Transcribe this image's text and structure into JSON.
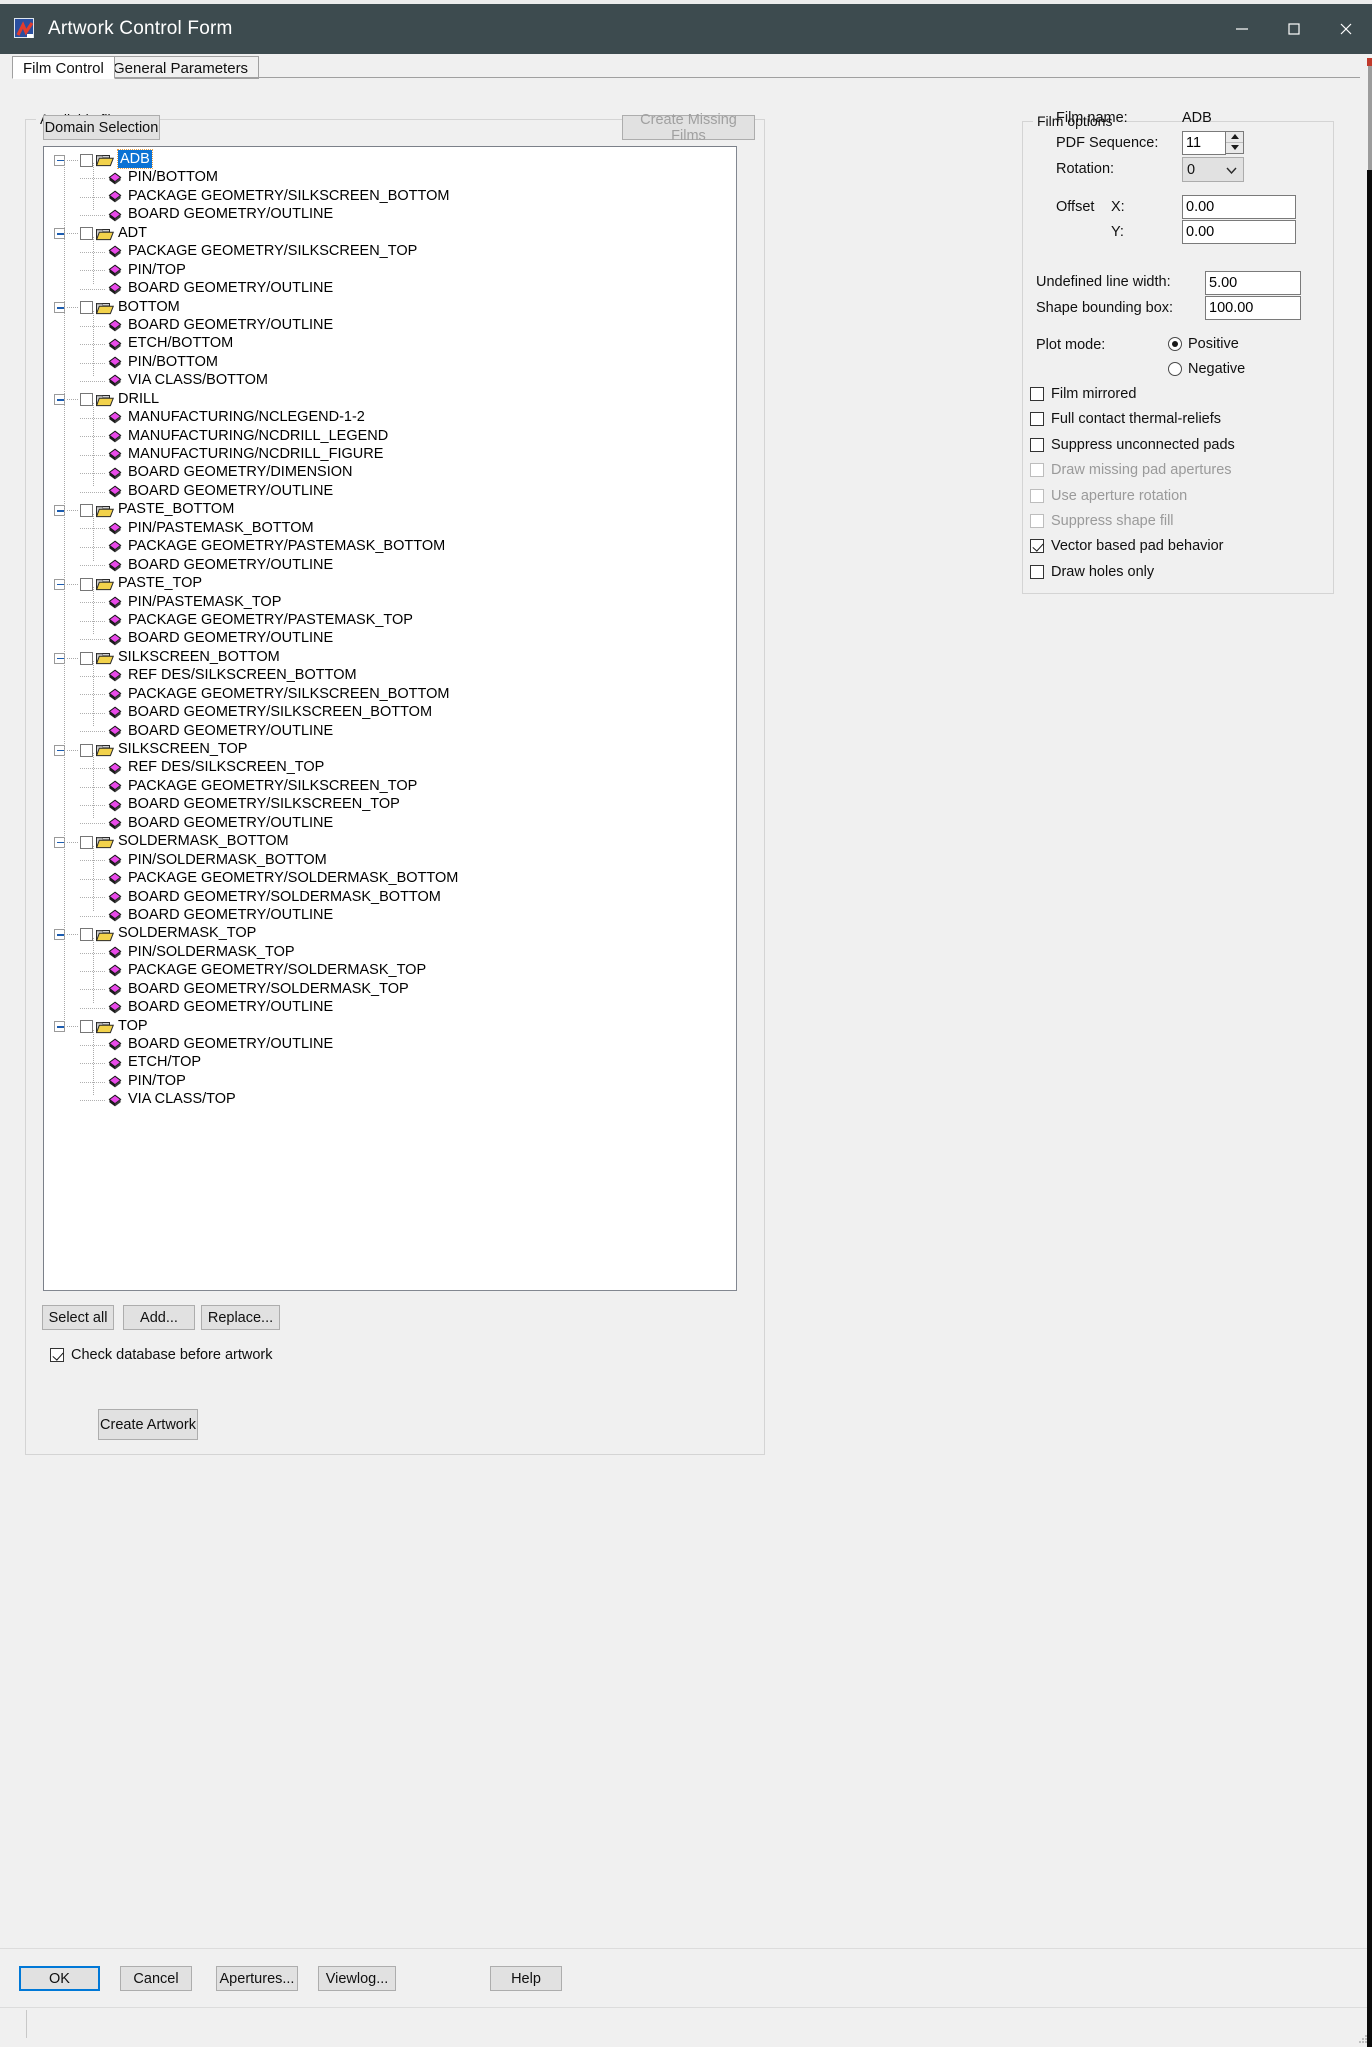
{
  "window": {
    "title": "Artwork Control Form",
    "icon": "app-artwork-icon",
    "minimize": "—",
    "maximize": "□",
    "close": "✕"
  },
  "tabs": [
    {
      "id": "film-control",
      "label": "Film Control",
      "active": true
    },
    {
      "id": "general-parameters",
      "label": "General Parameters",
      "active": false
    }
  ],
  "available_films": {
    "legend": "Available films",
    "domain_selection_label": "Domain Selection",
    "create_missing_films_label": "Create Missing Films",
    "create_missing_films_enabled": false,
    "select_all_label": "Select all",
    "add_label": "Add...",
    "replace_label": "Replace...",
    "check_database_label": "Check database before artwork",
    "check_database_checked": true,
    "create_artwork_label": "Create Artwork"
  },
  "tree": {
    "selected": "ADB",
    "groups": [
      {
        "name": "ADB",
        "expanded": true,
        "checked": false,
        "children": [
          "PIN/BOTTOM",
          "PACKAGE GEOMETRY/SILKSCREEN_BOTTOM",
          "BOARD GEOMETRY/OUTLINE"
        ]
      },
      {
        "name": "ADT",
        "expanded": true,
        "checked": false,
        "children": [
          "PACKAGE GEOMETRY/SILKSCREEN_TOP",
          "PIN/TOP",
          "BOARD GEOMETRY/OUTLINE"
        ]
      },
      {
        "name": "BOTTOM",
        "expanded": true,
        "checked": false,
        "children": [
          "BOARD GEOMETRY/OUTLINE",
          "ETCH/BOTTOM",
          "PIN/BOTTOM",
          "VIA CLASS/BOTTOM"
        ]
      },
      {
        "name": "DRILL",
        "expanded": true,
        "checked": false,
        "children": [
          "MANUFACTURING/NCLEGEND-1-2",
          "MANUFACTURING/NCDRILL_LEGEND",
          "MANUFACTURING/NCDRILL_FIGURE",
          "BOARD GEOMETRY/DIMENSION",
          "BOARD GEOMETRY/OUTLINE"
        ]
      },
      {
        "name": "PASTE_BOTTOM",
        "expanded": true,
        "checked": false,
        "children": [
          "PIN/PASTEMASK_BOTTOM",
          "PACKAGE GEOMETRY/PASTEMASK_BOTTOM",
          "BOARD GEOMETRY/OUTLINE"
        ]
      },
      {
        "name": "PASTE_TOP",
        "expanded": true,
        "checked": false,
        "children": [
          "PIN/PASTEMASK_TOP",
          "PACKAGE GEOMETRY/PASTEMASK_TOP",
          "BOARD GEOMETRY/OUTLINE"
        ]
      },
      {
        "name": "SILKSCREEN_BOTTOM",
        "expanded": true,
        "checked": false,
        "children": [
          "REF DES/SILKSCREEN_BOTTOM",
          "PACKAGE GEOMETRY/SILKSCREEN_BOTTOM",
          "BOARD GEOMETRY/SILKSCREEN_BOTTOM",
          "BOARD GEOMETRY/OUTLINE"
        ]
      },
      {
        "name": "SILKSCREEN_TOP",
        "expanded": true,
        "checked": false,
        "children": [
          "REF DES/SILKSCREEN_TOP",
          "PACKAGE GEOMETRY/SILKSCREEN_TOP",
          "BOARD GEOMETRY/SILKSCREEN_TOP",
          "BOARD GEOMETRY/OUTLINE"
        ]
      },
      {
        "name": "SOLDERMASK_BOTTOM",
        "expanded": true,
        "checked": false,
        "children": [
          "PIN/SOLDERMASK_BOTTOM",
          "PACKAGE GEOMETRY/SOLDERMASK_BOTTOM",
          "BOARD GEOMETRY/SOLDERMASK_BOTTOM",
          "BOARD GEOMETRY/OUTLINE"
        ]
      },
      {
        "name": "SOLDERMASK_TOP",
        "expanded": true,
        "checked": false,
        "children": [
          "PIN/SOLDERMASK_TOP",
          "PACKAGE GEOMETRY/SOLDERMASK_TOP",
          "BOARD GEOMETRY/SOLDERMASK_TOP",
          "BOARD GEOMETRY/OUTLINE"
        ]
      },
      {
        "name": "TOP",
        "expanded": true,
        "checked": false,
        "children": [
          "BOARD GEOMETRY/OUTLINE",
          "ETCH/TOP",
          "PIN/TOP",
          "VIA CLASS/TOP"
        ]
      }
    ]
  },
  "film_options": {
    "legend": "Film options",
    "film_name_label": "Film name:",
    "film_name_value": "ADB",
    "pdf_sequence_label": "PDF Sequence:",
    "pdf_sequence_value": "11",
    "rotation_label": "Rotation:",
    "rotation_value": "0",
    "offset_label": "Offset",
    "offset_x_label": "X:",
    "offset_x_value": "0.00",
    "offset_y_label": "Y:",
    "offset_y_value": "0.00",
    "undefined_line_width_label": "Undefined line width:",
    "undefined_line_width_value": "5.00",
    "shape_bounding_box_label": "Shape bounding box:",
    "shape_bounding_box_value": "100.00",
    "plot_mode_label": "Plot mode:",
    "plot_mode_positive": "Positive",
    "plot_mode_negative": "Negative",
    "plot_mode_selected": "Positive",
    "checkboxes": [
      {
        "label": "Film mirrored",
        "checked": false,
        "enabled": true
      },
      {
        "label": "Full contact thermal-reliefs",
        "checked": false,
        "enabled": true
      },
      {
        "label": "Suppress unconnected pads",
        "checked": false,
        "enabled": true
      },
      {
        "label": "Draw missing pad apertures",
        "checked": false,
        "enabled": false
      },
      {
        "label": "Use aperture rotation",
        "checked": false,
        "enabled": false
      },
      {
        "label": "Suppress shape fill",
        "checked": false,
        "enabled": false
      },
      {
        "label": "Vector based pad behavior",
        "checked": true,
        "enabled": true
      },
      {
        "label": "Draw holes only",
        "checked": false,
        "enabled": true
      }
    ]
  },
  "dialog_buttons": {
    "ok": "OK",
    "cancel": "Cancel",
    "apertures": "Apertures...",
    "viewlog": "Viewlog...",
    "help": "Help"
  },
  "colors": {
    "titlebar": "#3d4b4f",
    "selection": "#0a72d4",
    "diamond": "#e040e0",
    "folder": "#f4d35e",
    "accent": "#0078d7"
  }
}
